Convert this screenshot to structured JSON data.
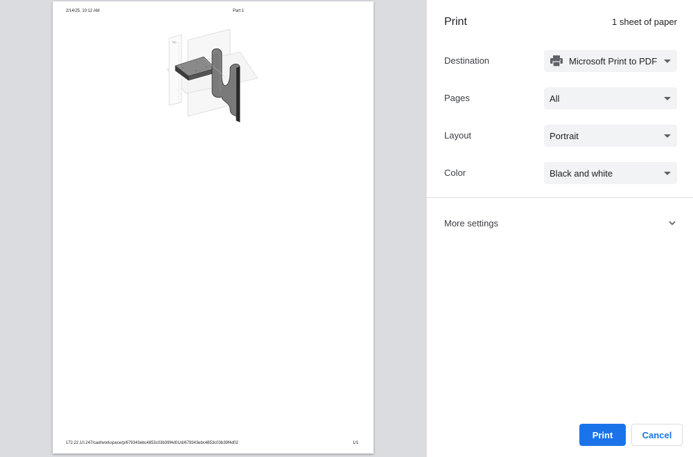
{
  "preview": {
    "header_date": "2/14/25, 10:12 AM",
    "header_title": "Part 1",
    "footer_url": "172.22.10.247/cad/workspace/p/679343ebc4853c03b39f4d01/d/679343ebc4853c03b39f4d02",
    "footer_page": "1/1"
  },
  "panel": {
    "title": "Print",
    "sheet_count": "1 sheet of paper",
    "destination": {
      "label": "Destination",
      "value": "Microsoft Print to PDF",
      "icon": "printer-icon"
    },
    "pages": {
      "label": "Pages",
      "value": "All"
    },
    "layout": {
      "label": "Layout",
      "value": "Portrait"
    },
    "color": {
      "label": "Color",
      "value": "Black and white"
    },
    "more_settings": {
      "label": "More settings",
      "icon": "chevron-down-icon"
    },
    "print_button": "Print",
    "cancel_button": "Cancel"
  },
  "colors": {
    "accent": "#1a73e8",
    "preview_bg": "#dadce0",
    "select_bg": "#f1f3f4"
  }
}
